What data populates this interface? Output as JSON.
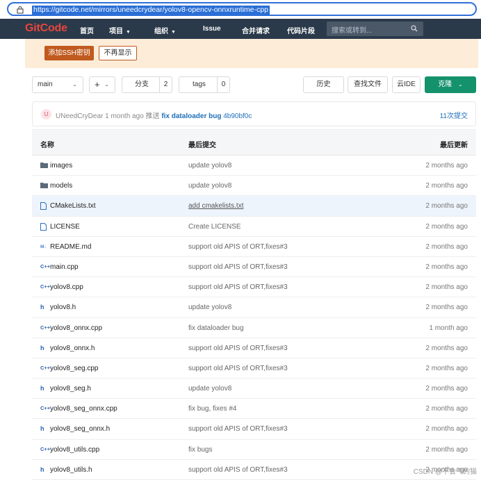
{
  "address_bar": {
    "url": "https://gitcode.net/mirrors/uneedcrydear/yolov8-opencv-onnxruntime-cpp"
  },
  "navbar": {
    "logo": "GitCode",
    "items": [
      {
        "label": "首页",
        "caret": false
      },
      {
        "label": "项目",
        "caret": true
      },
      {
        "label": "组织",
        "caret": true
      },
      {
        "label": "Issue",
        "caret": false
      },
      {
        "label": "合并请求",
        "caret": false
      },
      {
        "label": "代码片段",
        "caret": false
      }
    ],
    "search_placeholder": "搜索或转到..."
  },
  "notice": {
    "add_ssh_label": "添加SSH密钥",
    "dont_show_label": "不再显示"
  },
  "toolbar": {
    "branch": "main",
    "add_symbol": "+",
    "branches_label": "分支",
    "branches_count": "2",
    "tags_label": "tags",
    "tags_count": "0",
    "history_label": "历史",
    "find_file_label": "查找文件",
    "web_ide_label": "云IDE",
    "clone_label": "克隆"
  },
  "last_commit": {
    "avatar_letter": "U",
    "author": "UNeedCryDear",
    "time": "1 month ago",
    "action": "推送",
    "message": "fix dataloader bug",
    "hash": "4b90bf0c",
    "commit_count": "11次提交"
  },
  "file_table": {
    "headers": {
      "name": "名称",
      "last_commit": "最后提交",
      "last_update": "最后更新"
    },
    "rows": [
      {
        "icon": "folder-icon",
        "name": "images",
        "message": "update yolov8",
        "date": "2 months ago"
      },
      {
        "icon": "folder-icon",
        "name": "models",
        "message": "update yolov8",
        "date": "2 months ago"
      },
      {
        "icon": "file-icon",
        "name": "CMakeLists.txt",
        "message": "add cmakelists.txt",
        "date": "2 months ago",
        "highlighted": true
      },
      {
        "icon": "file-icon",
        "name": "LICENSE",
        "message": "Create LICENSE",
        "date": "2 months ago"
      },
      {
        "icon": "markdown-icon",
        "name": "README.md",
        "message": "support old APIS of ORT,fixes#3",
        "date": "2 months ago"
      },
      {
        "icon": "cpp-icon",
        "name": "main.cpp",
        "message": "support old APIS of ORT,fixes#3",
        "date": "2 months ago"
      },
      {
        "icon": "cpp-icon",
        "name": "yolov8.cpp",
        "message": "support old APIS of ORT,fixes#3",
        "date": "2 months ago"
      },
      {
        "icon": "header-icon",
        "name": "yolov8.h",
        "message": "update yolov8",
        "date": "2 months ago"
      },
      {
        "icon": "cpp-icon",
        "name": "yolov8_onnx.cpp",
        "message": "fix dataloader bug",
        "date": "1 month ago"
      },
      {
        "icon": "header-icon",
        "name": "yolov8_onnx.h",
        "message": "support old APIS of ORT,fixes#3",
        "date": "2 months ago"
      },
      {
        "icon": "cpp-icon",
        "name": "yolov8_seg.cpp",
        "message": "support old APIS of ORT,fixes#3",
        "date": "2 months ago"
      },
      {
        "icon": "header-icon",
        "name": "yolov8_seg.h",
        "message": "update yolov8",
        "date": "2 months ago"
      },
      {
        "icon": "cpp-icon",
        "name": "yolov8_seg_onnx.cpp",
        "message": "fix bug, fixes #4",
        "date": "2 months ago"
      },
      {
        "icon": "header-icon",
        "name": "yolov8_seg_onnx.h",
        "message": "support old APIS of ORT,fixes#3",
        "date": "2 months ago"
      },
      {
        "icon": "cpp-icon",
        "name": "yolov8_utils.cpp",
        "message": "fix bugs",
        "date": "2 months ago"
      },
      {
        "icon": "header-icon",
        "name": "yolov8_utils.h",
        "message": "support old APIS of ORT,fixes#3",
        "date": "2 months ago"
      }
    ]
  },
  "watermark": "CSDN @不会飞的猫",
  "colors": {
    "nav_bg": "#2b3a4a",
    "brand": "#e8453c",
    "accent_green": "#14926b",
    "link": "#1f6fb8",
    "notice_bg": "#fcecd8"
  }
}
